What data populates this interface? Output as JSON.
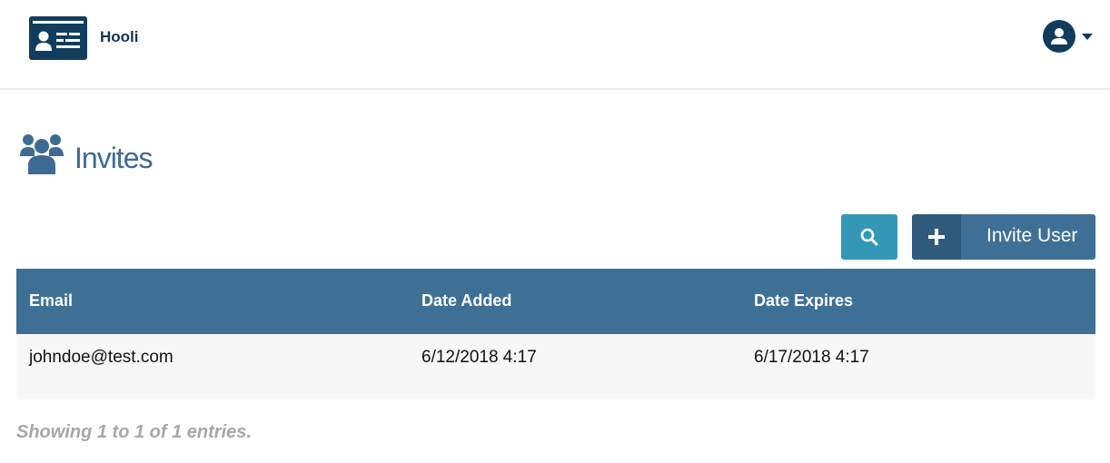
{
  "header": {
    "brand": "Hooli"
  },
  "page": {
    "title": "Invites"
  },
  "toolbar": {
    "invite_label": "Invite User"
  },
  "table": {
    "columns": [
      "Email",
      "Date Added",
      "Date Expires"
    ],
    "rows": [
      {
        "email": "johndoe@test.com",
        "date_added": "6/12/2018 4:17",
        "date_expires": "6/17/2018 4:17"
      }
    ]
  },
  "footer": {
    "entries_text": "Showing 1 to 1 of 1 entries."
  },
  "icons": {
    "logo": "id-card-icon",
    "avatar": "user-circle-icon",
    "caret": "caret-down-icon",
    "heading": "users-icon",
    "search": "search-icon",
    "add": "plus-icon"
  },
  "colors": {
    "navy": "#123c5c",
    "brand_text": "#14344f",
    "primary": "#3e7096",
    "primary_dark": "#2f5a7c",
    "search": "#3597b8",
    "title": "#3e6b93",
    "row_bg": "#f7f7f7",
    "muted": "#a7a7a7"
  }
}
